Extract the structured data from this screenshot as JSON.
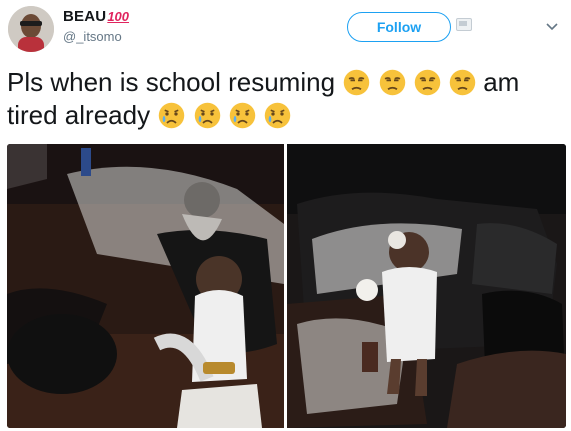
{
  "user": {
    "display_name": "BEAU",
    "name_emoji_text": "100",
    "handle": "@_itsomo"
  },
  "follow_button": {
    "label": "Follow"
  },
  "tweet": {
    "line1_text": "Pls when is school resuming",
    "line1_tail": "am",
    "line2_text": "tired already",
    "line1_emojis": [
      "unamused-face",
      "unamused-face",
      "unamused-face",
      "unamused-face"
    ],
    "line2_emojis": [
      "sad-but-relieved-face",
      "sad-but-relieved-face",
      "sad-but-relieved-face",
      "sad-but-relieved-face"
    ]
  },
  "colors": {
    "accent": "#1da1f2",
    "text": "#14171a",
    "muted": "#657786",
    "hundred_red": "#e0245e",
    "emoji_yellow": "#f7c23b",
    "tear_blue": "#5dadec"
  },
  "icons": [
    "verified-badge-icon",
    "chevron-down-icon"
  ]
}
